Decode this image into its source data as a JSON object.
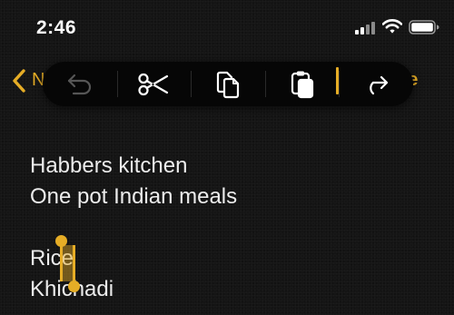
{
  "status_bar": {
    "time": "2:46"
  },
  "nav": {
    "back_label": "N",
    "done_label": "ne"
  },
  "edit_menu": {
    "items": [
      {
        "name": "undo",
        "icon": "undo-arrow-icon",
        "enabled": false
      },
      {
        "name": "cut",
        "icon": "scissors-icon",
        "enabled": true
      },
      {
        "name": "copy",
        "icon": "copy-icon",
        "enabled": true
      },
      {
        "name": "paste",
        "icon": "paste-icon",
        "enabled": true
      },
      {
        "name": "share",
        "icon": "share-arrow-icon",
        "enabled": true
      }
    ]
  },
  "note": {
    "lines": [
      "Habbers kitchen",
      "One pot Indian meals",
      "",
      "Rice",
      "Khichadi"
    ]
  },
  "colors": {
    "accent": "#e6ad26",
    "background": "#151515",
    "text": "#ececec",
    "menu_background": "#060606"
  }
}
